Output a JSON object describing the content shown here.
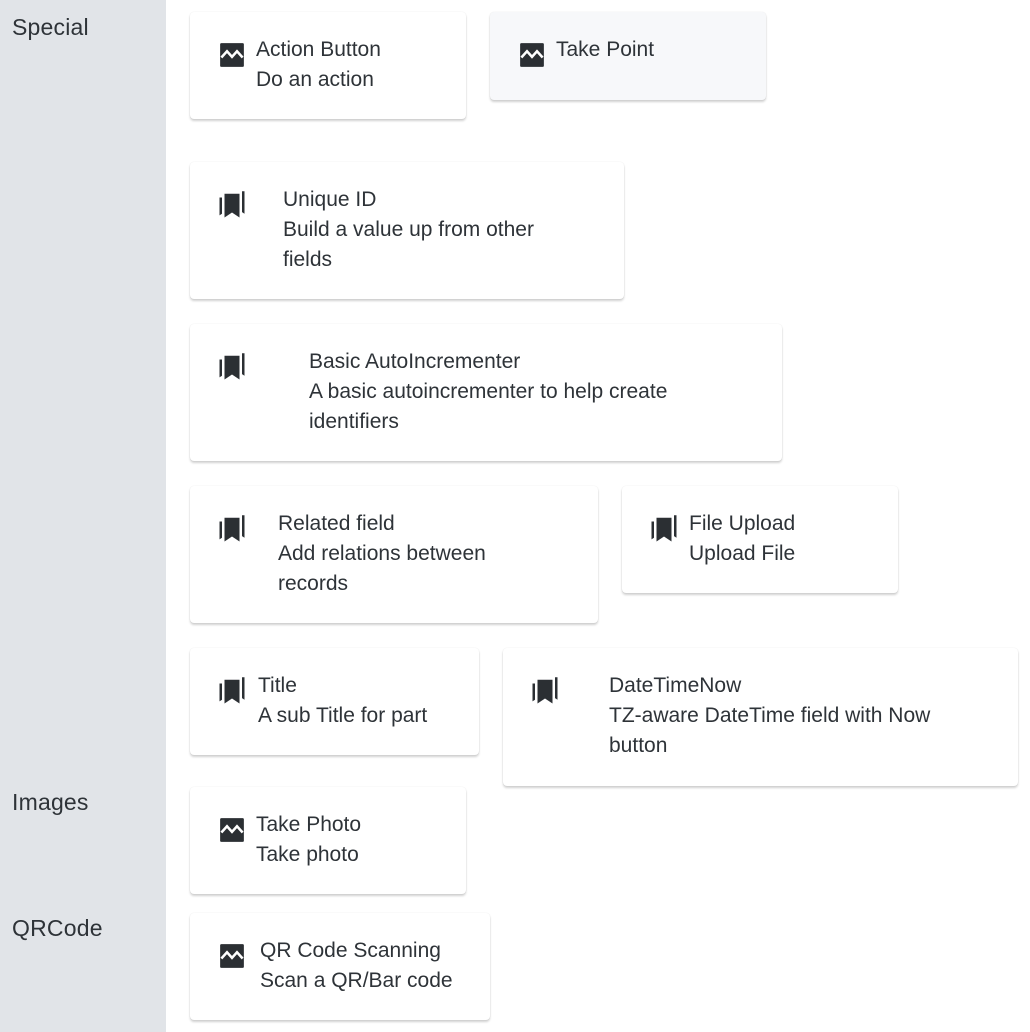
{
  "sections": [
    {
      "label": "Special"
    },
    {
      "label": "Images"
    },
    {
      "label": "QRCode"
    }
  ],
  "cards": {
    "action_button": {
      "title": "Action Button",
      "desc": "Do an action",
      "icon": "image-icon"
    },
    "take_point": {
      "title": "Take Point",
      "icon": "image-icon"
    },
    "unique_id": {
      "title": "Unique ID",
      "desc1": "Build a value up from other",
      "desc2": "fields",
      "icon": "bookmarks-icon"
    },
    "basic_autoincrementer": {
      "title": "Basic AutoIncrementer",
      "desc1": "A basic autoincrementer to help create",
      "desc2": "identifiers",
      "icon": "bookmarks-icon"
    },
    "related_field": {
      "title": "Related field",
      "desc1": "Add relations between",
      "desc2": "records",
      "icon": "bookmarks-icon"
    },
    "file_upload": {
      "title": "File Upload",
      "desc": "Upload File",
      "icon": "bookmarks-icon"
    },
    "title": {
      "title": "Title",
      "desc": "A sub Title for part",
      "icon": "bookmarks-icon"
    },
    "datetimenow": {
      "title": "DateTimeNow",
      "desc1": "TZ-aware DateTime field with Now",
      "desc2": "button",
      "icon": "bookmarks-icon"
    },
    "take_photo": {
      "title": "Take Photo",
      "desc": "Take photo",
      "icon": "image-icon"
    },
    "qr_code": {
      "title": "QR Code Scanning",
      "desc": "Scan a QR/Bar code",
      "icon": "image-icon"
    }
  },
  "colors": {
    "sidebar": "#e1e4e8",
    "text": "#2e3338",
    "icon": "#2b2f33"
  }
}
